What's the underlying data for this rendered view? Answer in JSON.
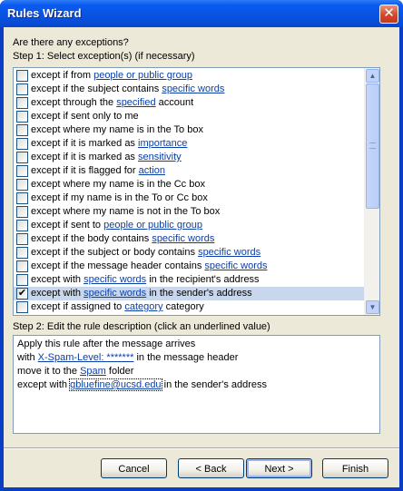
{
  "window": {
    "title": "Rules Wizard",
    "close_label": "✕"
  },
  "question": "Are there any exceptions?",
  "step1_label": "Step 1: Select exception(s) (if necessary)",
  "exceptions": [
    {
      "before": "except if from ",
      "link": "people or public group",
      "after": "",
      "checked": false
    },
    {
      "before": "except if the subject contains ",
      "link": "specific words",
      "after": "",
      "checked": false
    },
    {
      "before": "except through the ",
      "link": "specified",
      "after": " account",
      "checked": false
    },
    {
      "before": "except if sent only to me",
      "link": "",
      "after": "",
      "checked": false
    },
    {
      "before": "except where my name is in the To box",
      "link": "",
      "after": "",
      "checked": false
    },
    {
      "before": "except if it is marked as ",
      "link": "importance",
      "after": "",
      "checked": false
    },
    {
      "before": "except if it is marked as ",
      "link": "sensitivity",
      "after": "",
      "checked": false
    },
    {
      "before": "except if it is flagged for ",
      "link": "action",
      "after": "",
      "checked": false
    },
    {
      "before": "except where my name is in the Cc box",
      "link": "",
      "after": "",
      "checked": false
    },
    {
      "before": "except if my name is in the To or Cc box",
      "link": "",
      "after": "",
      "checked": false
    },
    {
      "before": "except where my name is not in the To box",
      "link": "",
      "after": "",
      "checked": false
    },
    {
      "before": "except if sent to ",
      "link": "people or public group",
      "after": "",
      "checked": false
    },
    {
      "before": "except if the body contains ",
      "link": "specific words",
      "after": "",
      "checked": false
    },
    {
      "before": "except if the subject or body contains ",
      "link": "specific words",
      "after": "",
      "checked": false
    },
    {
      "before": "except if the message header contains ",
      "link": "specific words",
      "after": "",
      "checked": false
    },
    {
      "before": "except with ",
      "link": "specific words",
      "after": " in the recipient's address",
      "checked": false
    },
    {
      "before": "except with ",
      "link": "specific words",
      "after": " in the sender's address",
      "checked": true
    },
    {
      "before": "except if assigned to ",
      "link": "category",
      "after": " category",
      "checked": false
    }
  ],
  "step2_label": "Step 2: Edit the rule description (click an underlined value)",
  "description": [
    {
      "before": "Apply this rule after the message arrives",
      "link": "",
      "after": ""
    },
    {
      "before": "with ",
      "link": "X-Spam-Level: *******",
      "after": " in the message header"
    },
    {
      "before": "move it to the ",
      "link": "Spam",
      "after": " folder"
    },
    {
      "before": "except with ",
      "link": "gbluefine@ucsd.edu",
      "after": " in the sender's address"
    }
  ],
  "buttons": {
    "cancel": "Cancel",
    "back": "< Back",
    "next": "Next >",
    "finish": "Finish"
  }
}
